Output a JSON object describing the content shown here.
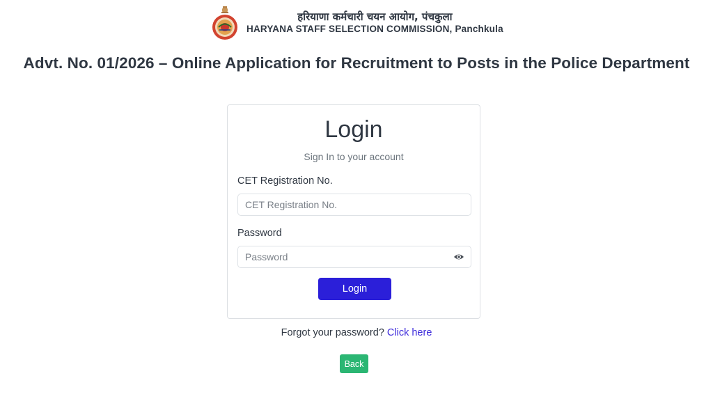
{
  "header": {
    "hindi_name": "हरियाणा कर्मचारी चयन आयोग, पंचकुला",
    "english_name": "HARYANA STAFF SELECTION COMMISSION, Panchkula",
    "emblem_icon": "haryana-state-emblem",
    "emblem_color": "#c8372d"
  },
  "page_title": "Advt. No. 01/2026 – Online Application for Recruitment to Posts in the Police Department",
  "login_card": {
    "title": "Login",
    "subtitle": "Sign In to your account",
    "cet_label": "CET Registration No.",
    "cet_placeholder": "CET Registration No.",
    "cet_value": "",
    "password_label": "Password",
    "password_placeholder": "Password",
    "password_value": "",
    "toggle_icon": "eye-icon",
    "login_button": "Login",
    "login_button_color": "#2b1fd9"
  },
  "forgot": {
    "text": "Forgot your password? ",
    "link": "Click here",
    "link_color": "#3d2bdb"
  },
  "back_button": {
    "label": "Back",
    "color": "#2bb673"
  }
}
